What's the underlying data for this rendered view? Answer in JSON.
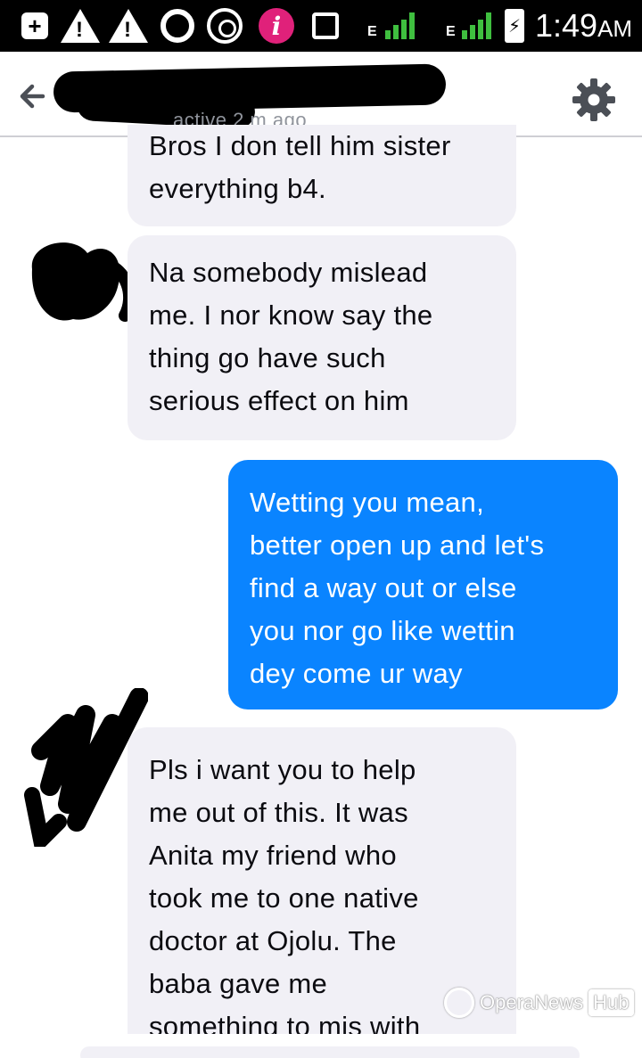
{
  "status_bar": {
    "time": "1:49",
    "ampm": "AM",
    "network_label": "E",
    "battery_glyph": "⚡",
    "icons": [
      "add-icon",
      "warning-icon",
      "warning-icon",
      "opera-icon",
      "whatsapp-icon",
      "info-icon",
      "cast-icon",
      "signal-icon",
      "signal-icon",
      "battery-icon"
    ],
    "signal_color": "#3fbf3f",
    "info_badge_color": "#e0217a"
  },
  "header": {
    "status_text": "active 2 m ago",
    "back_icon": "arrow-left-icon",
    "settings_icon": "gear-icon"
  },
  "messages": [
    {
      "direction": "incoming",
      "lines": [
        "Bros I don tell him sister",
        "everything b4."
      ]
    },
    {
      "direction": "incoming",
      "lines": [
        "Na somebody mislead",
        "me. I nor know say the",
        "thing go have such",
        "serious effect on him"
      ]
    },
    {
      "direction": "outgoing",
      "lines": [
        "Wetting you mean,",
        "better open up and let's",
        "find a way out or else",
        "you nor go like wettin",
        "dey come ur way"
      ]
    },
    {
      "direction": "incoming",
      "lines": [
        "Pls i want you to help",
        "me out of this. It was",
        "Anita my friend who",
        "took me to one native",
        "doctor at Ojolu. The",
        "baba gave me",
        "something to mis with"
      ]
    }
  ],
  "colors": {
    "incoming_bubble": "#f1f0f6",
    "outgoing_bubble": "#0a84ff",
    "incoming_text": "#0b0b10",
    "outgoing_text": "#ffffff"
  },
  "watermark": {
    "brand": "OperaNews",
    "hub": "Hub"
  }
}
